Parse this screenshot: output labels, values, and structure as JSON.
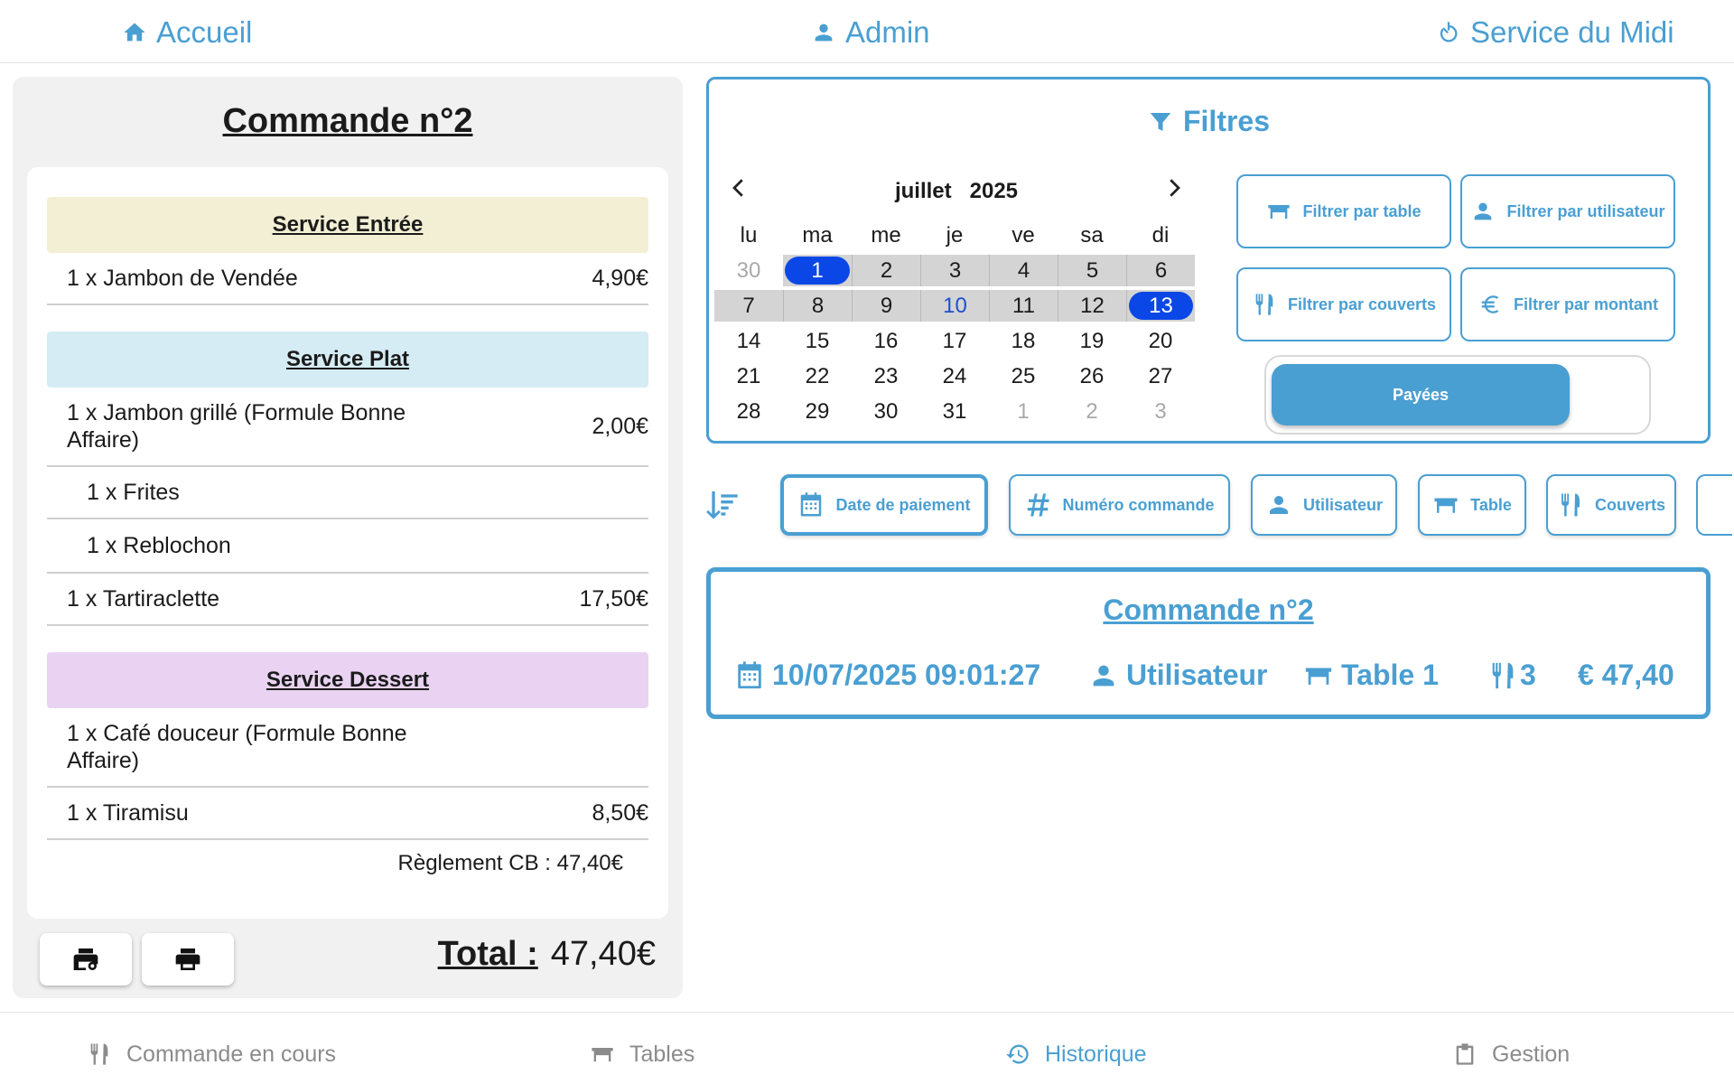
{
  "topnav": {
    "home_label": "Accueil",
    "admin_label": "Admin",
    "service_label": "Service du Midi"
  },
  "order": {
    "title": "Commande n°2",
    "sections": [
      {
        "label": "Service Entrée",
        "color": "#f3efd4"
      },
      {
        "label": "Service Plat",
        "color": "#d5ecf4"
      },
      {
        "label": "Service Dessert",
        "color": "#ead3f2"
      }
    ],
    "items": [
      {
        "name": "1 x Jambon de Vendée",
        "price": "4,90€"
      },
      {
        "name": "1 x Jambon grillé (Formule Bonne Affaire)",
        "price": "2,00€"
      },
      {
        "name": "1 x Frites",
        "price": ""
      },
      {
        "name": "1 x Reblochon",
        "price": ""
      },
      {
        "name": "1 x Tartiraclette",
        "price": "17,50€"
      },
      {
        "name": "1 x Café douceur (Formule Bonne Affaire)",
        "price": ""
      },
      {
        "name": "1 x Tiramisu",
        "price": "8,50€"
      }
    ],
    "payment": "Règlement CB : 47,40€",
    "total_label": "Total :",
    "total_value": "47,40€"
  },
  "filters": {
    "title": "Filtres",
    "calendar": {
      "month": "juillet",
      "year": "2025",
      "weekdays": [
        "lu",
        "ma",
        "me",
        "je",
        "ve",
        "sa",
        "di"
      ],
      "weeks": [
        [
          "30",
          "1",
          "2",
          "3",
          "4",
          "5",
          "6"
        ],
        [
          "7",
          "8",
          "9",
          "10",
          "11",
          "12",
          "13"
        ],
        [
          "14",
          "15",
          "16",
          "17",
          "18",
          "19",
          "20"
        ],
        [
          "21",
          "22",
          "23",
          "24",
          "25",
          "26",
          "27"
        ],
        [
          "28",
          "29",
          "30",
          "31",
          "1",
          "2",
          "3"
        ]
      ],
      "range_start": "1",
      "range_end": "13",
      "today": "10"
    },
    "buttons": {
      "by_table": "Filtrer par table",
      "by_user": "Filtrer par utilisateur",
      "by_covers": "Filtrer par couverts",
      "by_amount": "Filtrer par montant"
    },
    "paid_toggle": "Payées"
  },
  "sort": {
    "chips": {
      "date": "Date de paiement",
      "number": "Numéro commande",
      "user": "Utilisateur",
      "table": "Table",
      "covers": "Couverts"
    },
    "active": "Date de paiement"
  },
  "result": {
    "title": "Commande n°2",
    "datetime": "10/07/2025 09:01:27",
    "user": "Utilisateur",
    "table": "Table 1",
    "covers": "3",
    "amount": "€ 47,40"
  },
  "bottomnav": {
    "current_order": "Commande en cours",
    "tables": "Tables",
    "history": "Historique",
    "management": "Gestion",
    "active": "Historique"
  },
  "colors": {
    "accent": "#4a9fd2",
    "selected_day": "#0a47e6",
    "today_text": "#1f4fd0",
    "range_bg": "#d4d4d4"
  }
}
